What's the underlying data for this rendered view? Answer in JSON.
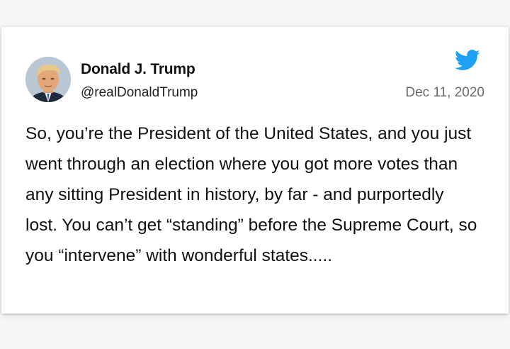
{
  "tweet": {
    "author": {
      "display_name": "Donald J. Trump",
      "handle": "@realDonaldTrump",
      "avatar_icon": "profile-photo"
    },
    "date": "Dec 11, 2020",
    "platform_icon": "twitter-bird-icon",
    "text": "So, you’re the President of the United States, and you just went through an election where you got more votes than any sitting President in history, by far - and purportedly lost. You can’t get “standing” before the Supreme Court, so you “intervene” with wonderful states....."
  },
  "colors": {
    "background": "#f6f6f6",
    "card": "#ffffff",
    "twitter_blue": "#1da1f2",
    "text": "#111111",
    "muted": "#6a6a6a"
  }
}
